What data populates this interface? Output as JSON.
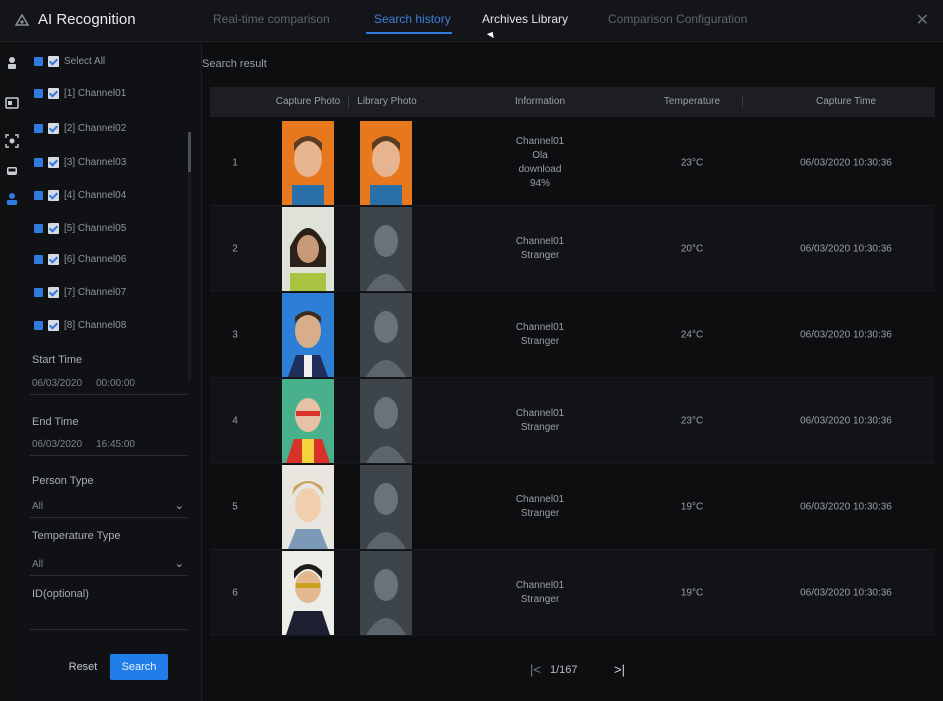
{
  "app": {
    "title": "AI Recognition",
    "close_glyph": "✕"
  },
  "tabs": [
    {
      "label": "Real-time comparison",
      "state": "inactive"
    },
    {
      "label": "Search history",
      "state": "selected"
    },
    {
      "label": "Archives Library",
      "state": "hover"
    },
    {
      "label": "Comparison Configuration",
      "state": "inactive"
    }
  ],
  "iconbar": [
    "person-icon",
    "id-card-icon",
    "face-scan-icon",
    "vehicle-icon",
    "face-search-icon"
  ],
  "sidebar": {
    "select_all": "Select All",
    "channels": [
      "[1] Channel01",
      "[2] Channel02",
      "[3] Channel03",
      "[4] Channel04",
      "[5] Channel05",
      "[6] Channel06",
      "[7] Channel07",
      "[8] Channel08"
    ],
    "start_time_label": "Start Time",
    "start_date": "06/03/2020",
    "start_clock": "00:00:00",
    "end_time_label": "End Time",
    "end_date": "06/03/2020",
    "end_clock": "16:45:00",
    "person_type_label": "Person Type",
    "person_type_value": "All",
    "temperature_type_label": "Temperature Type",
    "temperature_type_value": "All",
    "optional_label": "ID(optional)",
    "optional_value": "",
    "reset_label": "Reset",
    "search_label": "Search"
  },
  "results": {
    "title": "Search result",
    "columns": [
      "",
      "Capture Photo",
      "Library Photo",
      "Information",
      "Temperature",
      "Capture Time"
    ],
    "rows": [
      {
        "index": "1",
        "info": [
          "Channel01",
          "Ola",
          "download",
          "94%"
        ],
        "temperature": "23°C",
        "time": "06/03/2020 10:30:36",
        "capture": "orange",
        "library": "orange"
      },
      {
        "index": "2",
        "info": [
          "Channel01",
          "Stranger"
        ],
        "temperature": "20°C",
        "time": "06/03/2020 10:30:36",
        "capture": "person2",
        "library": "silhouette"
      },
      {
        "index": "3",
        "info": [
          "Channel01",
          "Stranger"
        ],
        "temperature": "24°C",
        "time": "06/03/2020 10:30:36",
        "capture": "blue",
        "library": "silhouette"
      },
      {
        "index": "4",
        "info": [
          "Channel01",
          "Stranger"
        ],
        "temperature": "23°C",
        "time": "06/03/2020 10:30:36",
        "capture": "person4",
        "library": "silhouette"
      },
      {
        "index": "5",
        "info": [
          "Channel01",
          "Stranger"
        ],
        "temperature": "19°C",
        "time": "06/03/2020 10:30:36",
        "capture": "person5",
        "library": "silhouette"
      },
      {
        "index": "6",
        "info": [
          "Channel01",
          "Stranger"
        ],
        "temperature": "19°C",
        "time": "06/03/2020 10:30:36",
        "capture": "person6",
        "library": "silhouette"
      }
    ]
  },
  "pagination": {
    "prev_glyph": "|<",
    "page_text": "1/167",
    "next_glyph": ">|"
  },
  "colors": {
    "accent": "#2f7be0",
    "background": "#0d0e10",
    "header": "#1c1e22"
  }
}
